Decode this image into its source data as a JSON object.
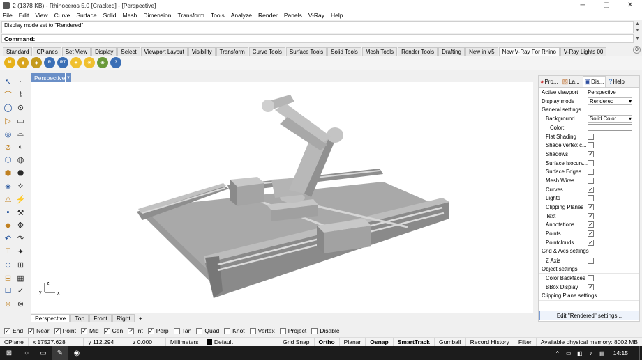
{
  "window": {
    "title": "2 (1378 KB) - Rhinoceros 5.0 [Cracked] - [Perspective]",
    "controls": [
      "─",
      "▢",
      "✕"
    ]
  },
  "menu": [
    "File",
    "Edit",
    "View",
    "Curve",
    "Surface",
    "Solid",
    "Mesh",
    "Dimension",
    "Transform",
    "Tools",
    "Analyze",
    "Render",
    "Panels",
    "V-Ray",
    "Help"
  ],
  "command": {
    "history": "Display mode set to \"Rendered\".",
    "prompt": "Command:"
  },
  "toolbar_tabs": [
    "Standard",
    "CPlanes",
    "Set View",
    "Display",
    "Select",
    "Viewport Layout",
    "Visibility",
    "Transform",
    "Curve Tools",
    "Surface Tools",
    "Solid Tools",
    "Mesh Tools",
    "Render Tools",
    "Drafting",
    "New in V5",
    "New V-Ray For Rhino",
    "V-Ray Lights 00"
  ],
  "toolbar_tabs_active": "New V-Ray For Rhino",
  "toolbar_icons": [
    {
      "label": "M",
      "color": "#e8b21a"
    },
    {
      "label": "◆",
      "color": "#d9a520"
    },
    {
      "label": "◆",
      "color": "#c49a1c"
    },
    {
      "label": "R",
      "color": "#3b6fb6"
    },
    {
      "label": "RT",
      "color": "#3b6fb6"
    },
    {
      "label": "☀",
      "color": "#f0c030"
    },
    {
      "label": "☀",
      "color": "#f0c030"
    },
    {
      "label": "❀",
      "color": "#6a9a3a"
    },
    {
      "label": "?",
      "color": "#3b6fb6"
    }
  ],
  "viewport": {
    "label": "Perspective",
    "axes": {
      "x": "x",
      "y": "y",
      "z": "z"
    },
    "tabs": [
      "Perspective",
      "Top",
      "Front",
      "Right"
    ],
    "add_tab": "+"
  },
  "panel": {
    "tabs": [
      {
        "icon": "color-wheel-icon",
        "label": "Pro..."
      },
      {
        "icon": "layers-icon",
        "label": "La..."
      },
      {
        "icon": "display-icon",
        "label": "Dis..."
      },
      {
        "icon": "help-icon",
        "label": "Help"
      }
    ],
    "active_viewport_label": "Active viewport",
    "active_viewport_value": "Perspective",
    "display_mode_label": "Display mode",
    "display_mode_value": "Rendered",
    "general_settings": "General settings",
    "background_label": "Background",
    "background_value": "Solid Color",
    "color_label": "Color:",
    "checks": [
      {
        "label": "Flat Shading",
        "checked": false
      },
      {
        "label": "Shade vertex c...",
        "checked": false
      },
      {
        "label": "Shadows",
        "checked": true
      },
      {
        "label": "Surface Isocurv...",
        "checked": false
      },
      {
        "label": "Surface Edges",
        "checked": false
      },
      {
        "label": "Mesh Wires",
        "checked": false
      },
      {
        "label": "Curves",
        "checked": true
      },
      {
        "label": "Lights",
        "checked": false
      },
      {
        "label": "Clipping Planes",
        "checked": true
      },
      {
        "label": "Text",
        "checked": true
      },
      {
        "label": "Annotations",
        "checked": true
      },
      {
        "label": "Points",
        "checked": true
      },
      {
        "label": "Pointclouds",
        "checked": true
      }
    ],
    "grid_axis_settings": "Grid & Axis settings",
    "z_axis_label": "Z Axis",
    "z_axis_checked": false,
    "object_settings": "Object settings",
    "color_backfaces_label": "Color Backfaces",
    "color_backfaces_checked": false,
    "bbox_display_label": "BBox Display",
    "bbox_display_checked": true,
    "clipping_plane_settings": "Clipping Plane settings",
    "edit_button": "Edit \"Rendered\" settings..."
  },
  "osnap": [
    {
      "label": "End",
      "checked": true
    },
    {
      "label": "Near",
      "checked": true
    },
    {
      "label": "Point",
      "checked": true
    },
    {
      "label": "Mid",
      "checked": true
    },
    {
      "label": "Cen",
      "checked": true
    },
    {
      "label": "Int",
      "checked": true
    },
    {
      "label": "Perp",
      "checked": true
    },
    {
      "label": "Tan",
      "checked": false
    },
    {
      "label": "Quad",
      "checked": false
    },
    {
      "label": "Knot",
      "checked": false
    },
    {
      "label": "Vertex",
      "checked": false
    },
    {
      "label": "Project",
      "checked": false
    },
    {
      "label": "Disable",
      "checked": false
    }
  ],
  "status": {
    "cplane": "CPlane",
    "x": "x 17527.628",
    "y": "y 112.294",
    "z": "z 0.000",
    "units": "Millimeters",
    "layer": "Default",
    "layer_color": "#000000",
    "buttons": [
      "Grid Snap",
      "Ortho",
      "Planar",
      "Osnap",
      "SmartTrack",
      "Gumball",
      "Record History",
      "Filter"
    ],
    "bold_buttons": [
      "Ortho",
      "Osnap",
      "SmartTrack"
    ],
    "memory": "Available physical memory: 8002 MB"
  },
  "taskbar": {
    "time": "14:15"
  }
}
